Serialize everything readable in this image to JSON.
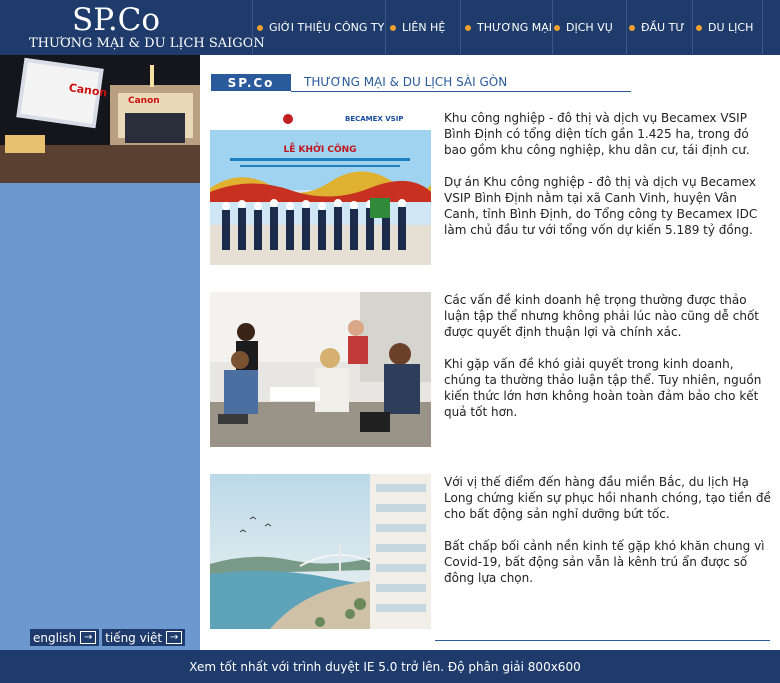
{
  "header": {
    "logo_title": "SP.Co",
    "logo_subtitle": "THƯƠNG MẠI & DU LỊCH SAIGON",
    "nav": [
      {
        "label": "GIỚI THIỆU CÔNG TY"
      },
      {
        "label": "LIÊN HỆ"
      },
      {
        "label": "THƯƠNG MẠI"
      },
      {
        "label": "DỊCH VỤ"
      },
      {
        "label": "ĐẦU TƯ"
      },
      {
        "label": "DU LỊCH"
      }
    ]
  },
  "sidebar": {
    "photo_sign_1": "Canon",
    "photo_sign_2": "Canon",
    "lang_en": "english",
    "lang_vi": "tiếng việt"
  },
  "section": {
    "badge": "SP.Co",
    "title": "THƯƠNG MẠI & DU LỊCH SÀI GÒN"
  },
  "articles": [
    {
      "p1": "Khu công nghiệp - đô thị và dịch vụ Becamex VSIP Bình Định có tổng diện tích gần 1.425 ha, trong đó bao gồm khu công nghiệp, khu dân cư, tái định cư.",
      "p2": "Dự án Khu công nghiệp - đô thị và dịch vụ Becamex VSIP Bình Định nằm tại xã Canh Vinh, huyện Vân Canh, tỉnh Bình Định, do Tổng công ty Becamex IDC làm chủ đầu tư với tổng vốn dự kiến 5.189 tỷ đồng.",
      "img_logo": "BECAMEX VSIP",
      "img_banner": "LỄ KHỞI CÔNG"
    },
    {
      "p1": "Các vấn đề kinh doanh hệ trọng thường được thảo luận tập thể nhưng không phải lúc nào cũng dễ chốt được quyết định thuận lợi và chính xác.",
      "p2": "Khi gặp vấn đề khó giải quyết trong kinh doanh, chúng ta thường thảo luận tập thể. Tuy nhiên, nguồn kiến thức lớn hơn không hoàn toàn đảm bảo cho kết quả tốt hơn."
    },
    {
      "p1": "Với vị thế điểm đến hàng đầu miền Bắc, du lịch Hạ Long chứng kiến sự phục hồi nhanh chóng, tạo tiền đề cho bất động sản nghỉ dưỡng bứt tốc.",
      "p2": "Bất chấp bối cảnh nền kinh tế gặp khó khăn chung vì Covid-19, bất động sản vẫn là kênh trú ẩn được số đông lựa chọn."
    }
  ],
  "footer": {
    "text": "Xem tốt nhất với trình duyệt IE 5.0 trở lên. Độ phân giải 800x600"
  },
  "colors": {
    "header_bg": "#1f3b6b",
    "sidebar_bg": "#6d98cf",
    "accent": "#2a5a9c",
    "nav_dot": "#f0a030"
  }
}
